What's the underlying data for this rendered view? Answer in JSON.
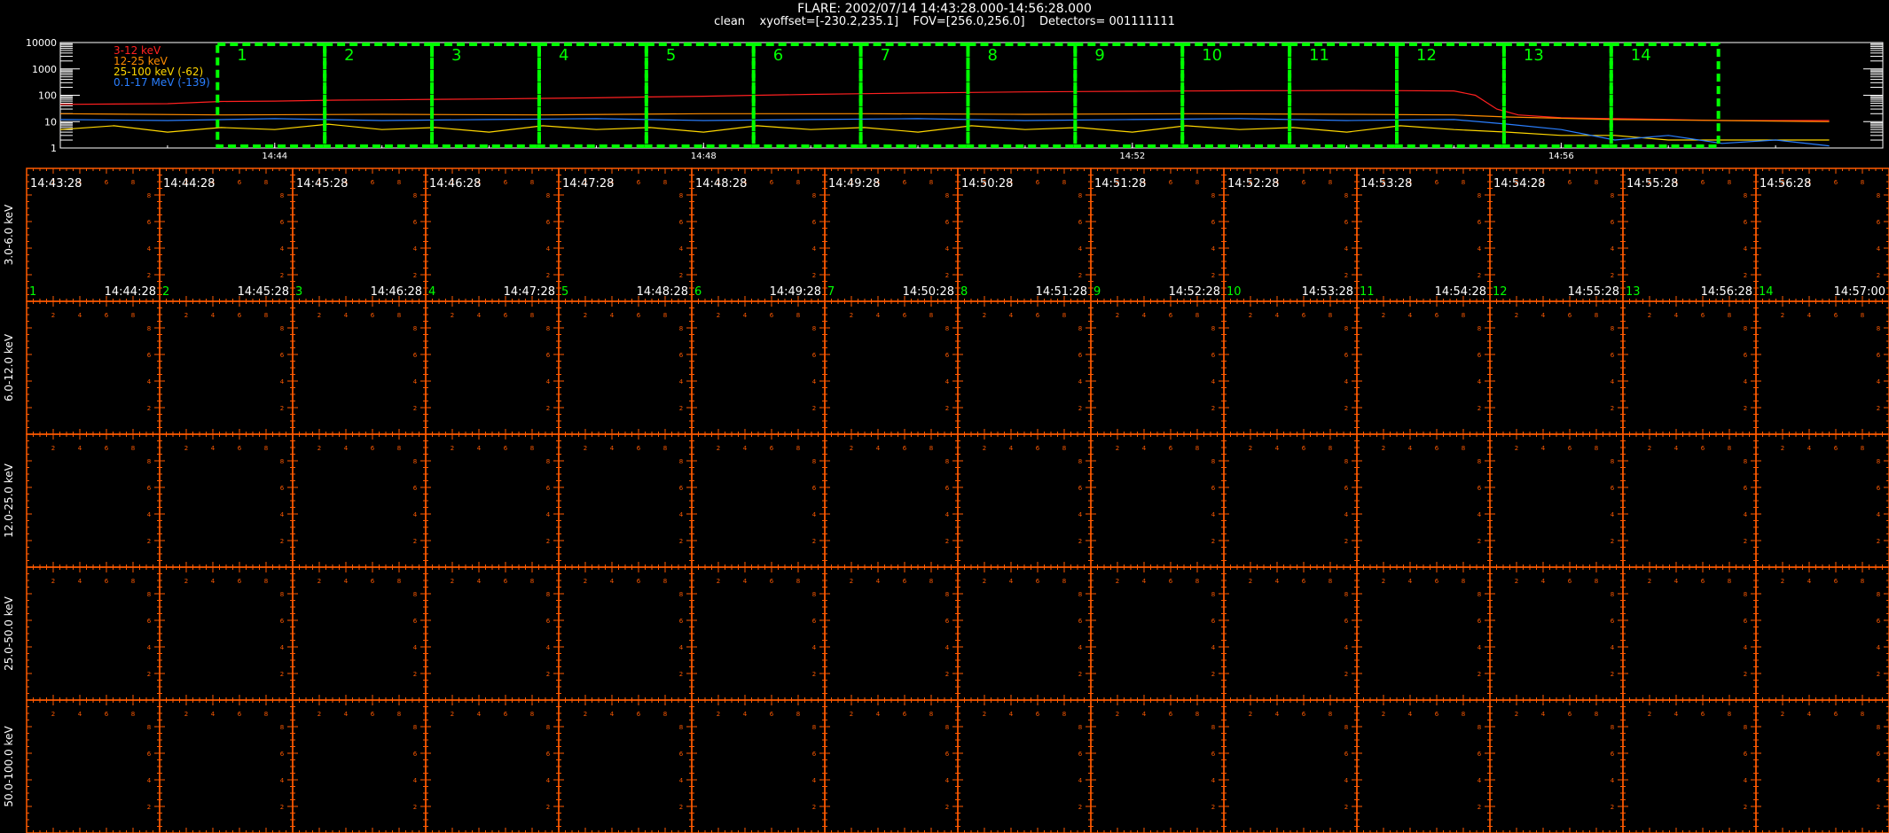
{
  "header": {
    "title": "FLARE: 2002/07/14 14:43:28.000-14:56:28.000",
    "subtitle": "clean    xyoffset=[-230.2,235.1]    FOV=[256.0,256.0]    Detectors= 001111111"
  },
  "colors": {
    "background": "#000000",
    "grid": "#ff5a00",
    "interval_box": "#00ff00",
    "text": "#ffffff",
    "interval_label": "#00ff00"
  },
  "chart_data": [
    {
      "type": "line",
      "title": "",
      "y_scale": "log",
      "ylim": [
        1,
        10000
      ],
      "y_tick_labels": [
        "10000",
        "1000",
        "100",
        "10",
        "1"
      ],
      "xlim": [
        "14:42:00",
        "14:59:00"
      ],
      "x_tick_labels": [
        "14:44",
        "14:48",
        "14:52",
        "14:56"
      ],
      "x_tick_minutes": [
        2,
        6,
        10,
        14
      ],
      "grid": false,
      "legend_position": "top-left",
      "series": [
        {
          "name": "3-12 keV",
          "color": "#ff2020",
          "points": [
            [
              0,
              45
            ],
            [
              2,
              48
            ],
            [
              3,
              58
            ],
            [
              4,
              60
            ],
            [
              5,
              65
            ],
            [
              6,
              67
            ],
            [
              7,
              70
            ],
            [
              8,
              72
            ],
            [
              9,
              76
            ],
            [
              10,
              80
            ],
            [
              11,
              86
            ],
            [
              12,
              92
            ],
            [
              13,
              100
            ],
            [
              14,
              108
            ],
            [
              15,
              115
            ],
            [
              16,
              122
            ],
            [
              17,
              128
            ],
            [
              18,
              134
            ],
            [
              19,
              138
            ],
            [
              20,
              142
            ],
            [
              21,
              145
            ],
            [
              22,
              148
            ],
            [
              23,
              150
            ],
            [
              24,
              152
            ],
            [
              25,
              150
            ],
            [
              26,
              146
            ],
            [
              26.4,
              100
            ],
            [
              26.8,
              30
            ],
            [
              27.2,
              18
            ],
            [
              28,
              14
            ],
            [
              29,
              13
            ],
            [
              30,
              12
            ],
            [
              31,
              11
            ],
            [
              32,
              11
            ],
            [
              33,
              11
            ]
          ]
        },
        {
          "name": "12-25 keV",
          "color": "#ff8c00",
          "points": [
            [
              0,
              20
            ],
            [
              3,
              18
            ],
            [
              6,
              19
            ],
            [
              9,
              18
            ],
            [
              12,
              20
            ],
            [
              15,
              20
            ],
            [
              18,
              19
            ],
            [
              21,
              20
            ],
            [
              24,
              19
            ],
            [
              26,
              18
            ],
            [
              27,
              15
            ],
            [
              29,
              12
            ],
            [
              31,
              11
            ],
            [
              33,
              10
            ]
          ]
        },
        {
          "name": "25-100 keV (-62)",
          "color": "#ffd700",
          "points": [
            [
              0,
              5
            ],
            [
              1,
              7
            ],
            [
              2,
              4
            ],
            [
              3,
              6
            ],
            [
              4,
              5
            ],
            [
              5,
              8
            ],
            [
              6,
              5
            ],
            [
              7,
              6
            ],
            [
              8,
              4
            ],
            [
              9,
              7
            ],
            [
              10,
              5
            ],
            [
              11,
              6
            ],
            [
              12,
              4
            ],
            [
              13,
              7
            ],
            [
              14,
              5
            ],
            [
              15,
              6
            ],
            [
              16,
              4
            ],
            [
              17,
              7
            ],
            [
              18,
              5
            ],
            [
              19,
              6
            ],
            [
              20,
              4
            ],
            [
              21,
              7
            ],
            [
              22,
              5
            ],
            [
              23,
              6
            ],
            [
              24,
              4
            ],
            [
              25,
              7
            ],
            [
              26,
              5
            ],
            [
              27,
              4
            ],
            [
              28,
              3
            ],
            [
              29,
              3
            ],
            [
              30,
              2
            ],
            [
              31,
              2
            ],
            [
              32,
              2
            ],
            [
              33,
              2
            ]
          ]
        },
        {
          "name": "0.1-17 MeV (-139)",
          "color": "#2a7fff",
          "points": [
            [
              0,
              12
            ],
            [
              2,
              11
            ],
            [
              4,
              13
            ],
            [
              6,
              11
            ],
            [
              8,
              12
            ],
            [
              10,
              13
            ],
            [
              12,
              11
            ],
            [
              14,
              12
            ],
            [
              16,
              13
            ],
            [
              18,
              11
            ],
            [
              20,
              12
            ],
            [
              22,
              13
            ],
            [
              24,
              11
            ],
            [
              26,
              12
            ],
            [
              27,
              8
            ],
            [
              28,
              5
            ],
            [
              29,
              2
            ],
            [
              30,
              3
            ],
            [
              31,
              1.5
            ],
            [
              32,
              2
            ],
            [
              33,
              1.2
            ]
          ]
        }
      ]
    },
    {
      "type": "image_grid",
      "title": "",
      "row_labels": [
        "3.0-6.0 keV",
        "6.0-12.0 keV",
        "12.0-25.0 keV",
        "25.0-50.0 keV",
        "50.0-100.0 keV"
      ],
      "columns": [
        {
          "index": "1",
          "start": "14:43:28",
          "end": "14:44:28"
        },
        {
          "index": "2",
          "start": "14:44:28",
          "end": "14:45:28"
        },
        {
          "index": "3",
          "start": "14:45:28",
          "end": "14:46:28"
        },
        {
          "index": "4",
          "start": "14:46:28",
          "end": "14:47:28"
        },
        {
          "index": "5",
          "start": "14:47:28",
          "end": "14:48:28"
        },
        {
          "index": "6",
          "start": "14:48:28",
          "end": "14:49:28"
        },
        {
          "index": "7",
          "start": "14:49:28",
          "end": "14:50:28"
        },
        {
          "index": "8",
          "start": "14:50:28",
          "end": "14:51:28"
        },
        {
          "index": "9",
          "start": "14:51:28",
          "end": "14:52:28"
        },
        {
          "index": "10",
          "start": "14:52:28",
          "end": "14:53:28"
        },
        {
          "index": "11",
          "start": "14:53:28",
          "end": "14:54:28"
        },
        {
          "index": "12",
          "start": "14:54:28",
          "end": "14:55:28"
        },
        {
          "index": "13",
          "start": "14:55:28",
          "end": "14:56:28"
        },
        {
          "index": "14",
          "start": "14:56:28",
          "end": "14:57:00"
        }
      ],
      "axis_tick_labels": [
        "2",
        "4",
        "6",
        "8"
      ]
    }
  ]
}
